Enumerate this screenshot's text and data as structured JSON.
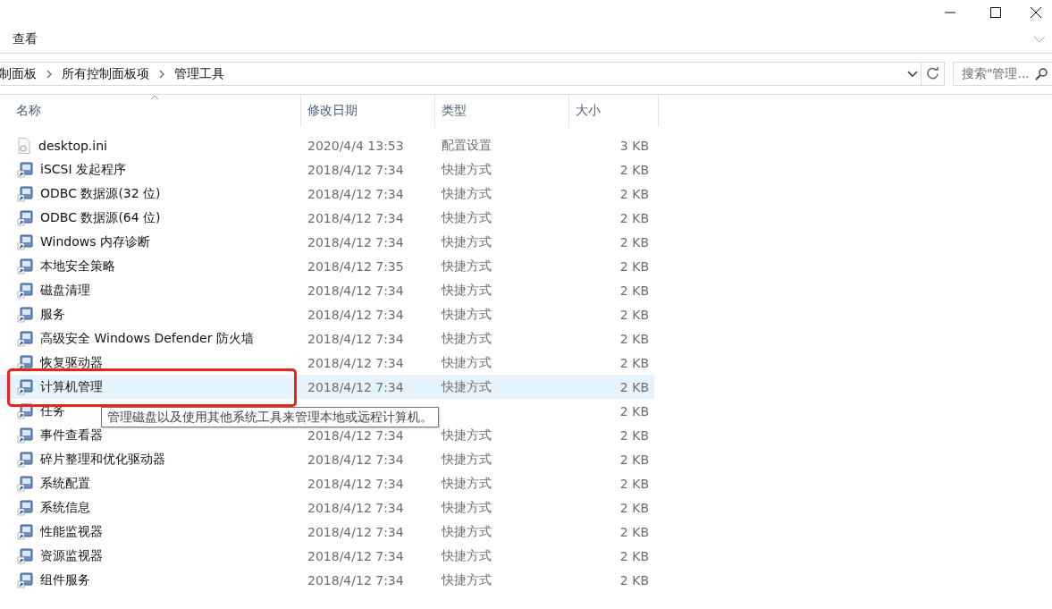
{
  "ribbon": {
    "tabs": [
      {
        "label": "查看",
        "selected": false
      }
    ]
  },
  "address_bar": {
    "breadcrumbs": [
      "制面板",
      "所有控制面板项",
      "管理工具"
    ],
    "search": {
      "placeholder": "搜索\"管理..."
    }
  },
  "table": {
    "columns": [
      {
        "label": "名称",
        "sorted": true
      },
      {
        "label": "修改日期",
        "sorted": false
      },
      {
        "label": "类型",
        "sorted": false
      },
      {
        "label": "大小",
        "sorted": false
      }
    ],
    "rows": [
      {
        "kind": "file",
        "name": "desktop.ini",
        "date": "2020/4/4 13:53",
        "type": "配置设置",
        "size": "3 KB",
        "selected": false
      },
      {
        "kind": "shortcut",
        "name": "iSCSI 发起程序",
        "date": "2018/4/12 7:34",
        "type": "快捷方式",
        "size": "2 KB",
        "selected": false
      },
      {
        "kind": "shortcut",
        "name": "ODBC 数据源(32 位)",
        "date": "2018/4/12 7:34",
        "type": "快捷方式",
        "size": "2 KB",
        "selected": false
      },
      {
        "kind": "shortcut",
        "name": "ODBC 数据源(64 位)",
        "date": "2018/4/12 7:34",
        "type": "快捷方式",
        "size": "2 KB",
        "selected": false
      },
      {
        "kind": "shortcut",
        "name": "Windows 内存诊断",
        "date": "2018/4/12 7:34",
        "type": "快捷方式",
        "size": "2 KB",
        "selected": false
      },
      {
        "kind": "shortcut",
        "name": "本地安全策略",
        "date": "2018/4/12 7:35",
        "type": "快捷方式",
        "size": "2 KB",
        "selected": false
      },
      {
        "kind": "shortcut",
        "name": "磁盘清理",
        "date": "2018/4/12 7:34",
        "type": "快捷方式",
        "size": "2 KB",
        "selected": false
      },
      {
        "kind": "shortcut",
        "name": "服务",
        "date": "2018/4/12 7:34",
        "type": "快捷方式",
        "size": "2 KB",
        "selected": false
      },
      {
        "kind": "shortcut",
        "name": "高级安全 Windows Defender 防火墙",
        "date": "2018/4/12 7:34",
        "type": "快捷方式",
        "size": "2 KB",
        "selected": false
      },
      {
        "kind": "shortcut",
        "name": "恢复驱动器",
        "date": "2018/4/12 7:34",
        "type": "快捷方式",
        "size": "2 KB",
        "selected": false
      },
      {
        "kind": "shortcut",
        "name": "计算机管理",
        "date": "2018/4/12 7:34",
        "type": "快捷方式",
        "size": "2 KB",
        "selected": true
      },
      {
        "kind": "shortcut",
        "name": "任务",
        "size": "2 KB",
        "selected": false
      },
      {
        "kind": "shortcut",
        "name": "事件查看器",
        "date": "2018/4/12 7:34",
        "type": "快捷方式",
        "size": "2 KB",
        "selected": false
      },
      {
        "kind": "shortcut",
        "name": "碎片整理和优化驱动器",
        "date": "2018/4/12 7:34",
        "type": "快捷方式",
        "size": "2 KB",
        "selected": false
      },
      {
        "kind": "shortcut",
        "name": "系统配置",
        "date": "2018/4/12 7:34",
        "type": "快捷方式",
        "size": "2 KB",
        "selected": false
      },
      {
        "kind": "shortcut",
        "name": "系统信息",
        "date": "2018/4/12 7:34",
        "type": "快捷方式",
        "size": "2 KB",
        "selected": false
      },
      {
        "kind": "shortcut",
        "name": "性能监视器",
        "date": "2018/4/12 7:34",
        "type": "快捷方式",
        "size": "2 KB",
        "selected": false
      },
      {
        "kind": "shortcut",
        "name": "资源监视器",
        "date": "2018/4/12 7:34",
        "type": "快捷方式",
        "size": "2 KB",
        "selected": false
      },
      {
        "kind": "shortcut",
        "name": "组件服务",
        "date": "2018/4/12 7:34",
        "type": "快捷方式",
        "size": "2 KB",
        "selected": false
      }
    ]
  },
  "tooltip": {
    "text": "管理磁盘以及使用其他系统工具来管理本地或远程计算机。"
  }
}
